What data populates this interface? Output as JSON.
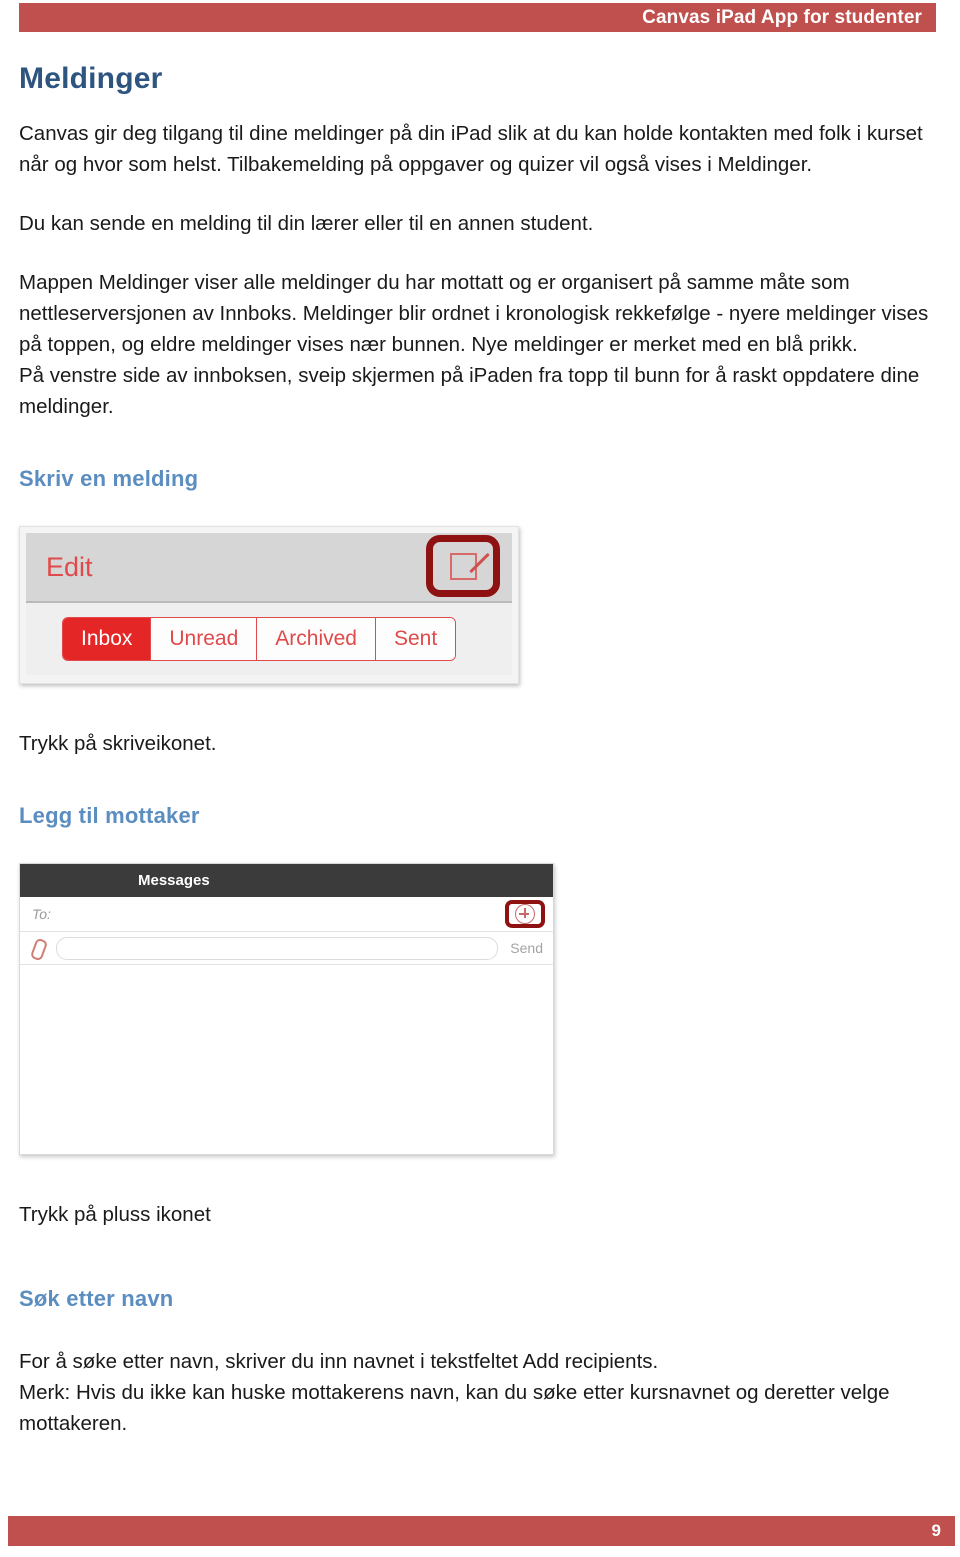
{
  "header": {
    "title": "Canvas iPad App for studenter",
    "bar_color": "#C0504D"
  },
  "page_title": "Meldinger",
  "colors": {
    "title_blue": "#2E5480",
    "heading_blue": "#5B8DC0",
    "accent_red": "#C0504D",
    "highlight_red": "#8F1212",
    "canvas_red": "#E52626"
  },
  "intro": {
    "paragraph_1": "Canvas gir deg tilgang til dine meldinger på din iPad slik at du kan holde kontakten med folk i kurset når og hvor som helst. Tilbakemelding på oppgaver og quizer vil også vises i Meldinger.",
    "paragraph_2": "Du kan sende en melding til din lærer eller til en annen student.",
    "paragraph_3": "Mappen Meldinger viser alle meldinger du har mottatt og er organisert på samme måte som nettleserversjonen av Innboks. Meldinger blir ordnet i kronologisk rekkefølge - nyere meldinger vises på toppen, og eldre meldinger vises nær bunnen. Nye meldinger er merket med en blå prikk.",
    "paragraph_4": "På venstre side av innboksen, sveip skjermen på iPaden fra topp til bunn for å raskt oppdatere dine meldinger."
  },
  "section_compose": {
    "heading": "Skriv en melding",
    "caption": "Trykk på skriveikonet.",
    "figure": {
      "edit_label": "Edit",
      "compose_icon_name": "compose-icon",
      "tabs": [
        {
          "label": "Inbox",
          "active": true
        },
        {
          "label": "Unread",
          "active": false
        },
        {
          "label": "Archived",
          "active": false
        },
        {
          "label": "Sent",
          "active": false
        }
      ]
    }
  },
  "section_recipient": {
    "heading": "Legg til mottaker",
    "caption": "Trykk på pluss ikonet",
    "figure": {
      "titlebar": "Messages",
      "to_label": "To:",
      "plus_icon_name": "plus-circle-icon",
      "attachment_icon_name": "paperclip-icon",
      "message_placeholder": "",
      "send_label": "Send"
    }
  },
  "section_search": {
    "heading": "Søk etter navn",
    "paragraph_1": "For å søke etter navn, skriver du inn navnet i tekstfeltet Add recipients.",
    "paragraph_2": "Merk: Hvis du ikke kan huske mottakerens navn, kan du søke etter kursnavnet og deretter velge mottakeren."
  },
  "footer": {
    "page_number": "9"
  }
}
